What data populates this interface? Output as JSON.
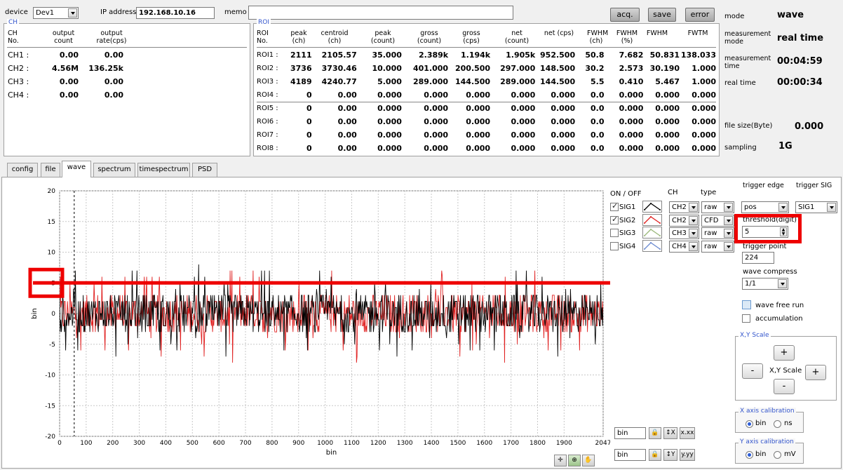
{
  "top": {
    "device_label": "device",
    "device_value": "Dev1",
    "ip_label": "IP address",
    "ip_value": "192.168.10.16",
    "memo_label": "memo",
    "memo_value": "",
    "acq_button": "acq.",
    "save_button": "save",
    "error_button": "error"
  },
  "status": {
    "mode_label": "mode",
    "mode_value": "wave",
    "meas_mode_label": "measurement mode",
    "meas_mode_value": "real time",
    "meas_time_label": "measurement time",
    "meas_time_value": "00:04:59",
    "real_time_label": "real time",
    "real_time_value": "00:00:34",
    "file_size_label": "file size(Byte)",
    "file_size_value": "0.000",
    "sampling_label": "sampling",
    "sampling_value": "1G"
  },
  "ch_panel": {
    "title": "CH",
    "headers": [
      "CH No.",
      "output count",
      "output rate(cps)"
    ],
    "rows": [
      {
        "name": "CH1 :",
        "count": "0.00",
        "rate": "0.00"
      },
      {
        "name": "CH2 :",
        "count": "4.56M",
        "rate": "136.25k"
      },
      {
        "name": "CH3 :",
        "count": "0.00",
        "rate": "0.00"
      },
      {
        "name": "CH4 :",
        "count": "0.00",
        "rate": "0.00"
      }
    ]
  },
  "roi_panel": {
    "title": "ROI",
    "headers": [
      "ROI No.",
      "peak (ch)",
      "centroid (ch)",
      "peak (count)",
      "gross (count)",
      "gross (cps)",
      "net (count)",
      "net (cps)",
      "FWHM (ch)",
      "FWHM (%)",
      "FWHM",
      "FWTM"
    ],
    "rows": [
      [
        "ROI1 :",
        "2111",
        "2105.57",
        "35.000",
        "2.389k",
        "1.194k",
        "1.905k",
        "952.500",
        "50.8",
        "7.682",
        "50.831",
        "138.033"
      ],
      [
        "ROI2 :",
        "3736",
        "3730.46",
        "10.000",
        "401.000",
        "200.500",
        "297.000",
        "148.500",
        "30.2",
        "2.573",
        "30.190",
        "1.000"
      ],
      [
        "ROI3 :",
        "4189",
        "4240.77",
        "5.000",
        "289.000",
        "144.500",
        "289.000",
        "144.500",
        "5.5",
        "0.410",
        "5.467",
        "1.000"
      ],
      [
        "ROI4 :",
        "0",
        "0.00",
        "0.000",
        "0.000",
        "0.000",
        "0.000",
        "0.000",
        "0.0",
        "0.000",
        "0.000",
        "0.000"
      ],
      [
        "ROI5 :",
        "0",
        "0.00",
        "0.000",
        "0.000",
        "0.000",
        "0.000",
        "0.000",
        "0.0",
        "0.000",
        "0.000",
        "0.000"
      ],
      [
        "ROI6 :",
        "0",
        "0.00",
        "0.000",
        "0.000",
        "0.000",
        "0.000",
        "0.000",
        "0.0",
        "0.000",
        "0.000",
        "0.000"
      ],
      [
        "ROI7 :",
        "0",
        "0.00",
        "0.000",
        "0.000",
        "0.000",
        "0.000",
        "0.000",
        "0.0",
        "0.000",
        "0.000",
        "0.000"
      ],
      [
        "ROI8 :",
        "0",
        "0.00",
        "0.000",
        "0.000",
        "0.000",
        "0.000",
        "0.000",
        "0.0",
        "0.000",
        "0.000",
        "0.000"
      ]
    ]
  },
  "tabs": [
    "config",
    "file",
    "wave",
    "spectrum",
    "timespectrum",
    "PSD"
  ],
  "active_tab": "wave",
  "sig_panel": {
    "onoff_label": "ON / OFF",
    "ch_label": "CH",
    "type_label": "type",
    "signals": [
      {
        "name": "SIG1",
        "checked": true,
        "ch": "CH2",
        "type": "raw",
        "color": "#000000"
      },
      {
        "name": "SIG2",
        "checked": true,
        "ch": "CH2",
        "type": "CFD",
        "color": "#e02020"
      },
      {
        "name": "SIG3",
        "checked": false,
        "ch": "CH3",
        "type": "raw",
        "color": "#9ab87a"
      },
      {
        "name": "SIG4",
        "checked": false,
        "ch": "CH4",
        "type": "raw",
        "color": "#6a8ad0"
      }
    ]
  },
  "trigger": {
    "edge_label": "trigger edge",
    "edge_value": "pos",
    "sig_label": "trigger SIG",
    "sig_value": "SIG1",
    "threshold_label": "threshold(digit)",
    "threshold_value": "5",
    "point_label": "trigger point",
    "point_value": "224",
    "compress_label": "wave compress",
    "compress_value": "1/1",
    "free_run_label": "wave free run",
    "accumulation_label": "accumulation"
  },
  "scale": {
    "title": "X,Y Scale",
    "center_label": "X,Y Scale",
    "plus": "+",
    "minus": "-"
  },
  "x_calib": {
    "title": "X axis calibration",
    "opt1": "bin",
    "opt2": "ns",
    "selected": "bin"
  },
  "y_calib": {
    "title": "Y axis calibration",
    "opt1": "bin",
    "opt2": "mV",
    "selected": "bin"
  },
  "axis_units": {
    "x_unit_box": "bin",
    "y_unit_box": "bin"
  },
  "chart_data": {
    "type": "line",
    "xlabel": "bin",
    "ylabel": "bin",
    "xlim": [
      0,
      2047
    ],
    "ylim": [
      -20,
      20
    ],
    "x_ticks": [
      "0",
      "100",
      "200",
      "300",
      "400",
      "500",
      "600",
      "700",
      "800",
      "900",
      "1000",
      "1100",
      "1200",
      "1300",
      "1400",
      "1500",
      "1600",
      "1700",
      "1800",
      "1900",
      "2047"
    ],
    "y_ticks": [
      "20",
      "15",
      "10",
      "5",
      "0",
      "-5",
      "-10",
      "-15",
      "-20"
    ],
    "trigger_marker_x": 55,
    "threshold_y": 5,
    "series": [
      {
        "color": "#000000",
        "noise_amplitude": 3,
        "spike_max": 8,
        "spike_min": -7
      },
      {
        "color": "#e02020",
        "noise_amplitude": 3,
        "spike_max": 7,
        "spike_min": -8
      }
    ]
  },
  "highlight_color": "#ee0000"
}
